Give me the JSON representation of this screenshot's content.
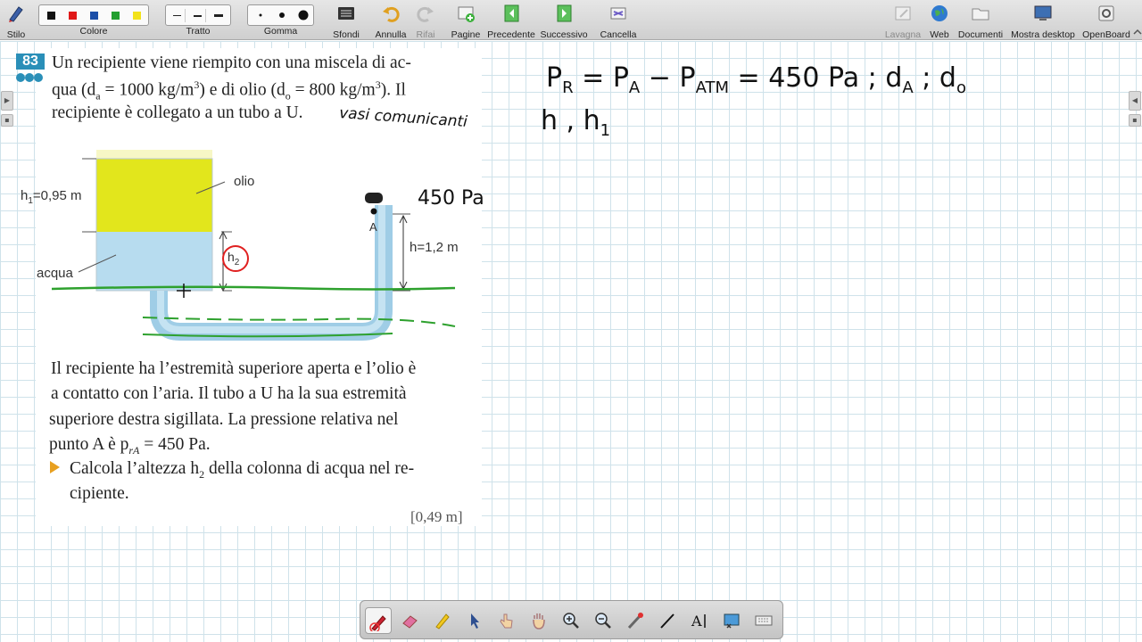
{
  "toolbar": {
    "stylus_label": "Stilo",
    "color_label": "Colore",
    "stroke_label": "Tratto",
    "eraser_label": "Gomma",
    "backgrounds_label": "Sfondi",
    "undo_label": "Annulla",
    "redo_label": "Rifai",
    "pages_label": "Pagine",
    "previous_label": "Precedente",
    "next_label": "Successivo",
    "clear_label": "Cancella",
    "board_label": "Lavagna",
    "web_label": "Web",
    "documents_label": "Documenti",
    "show_desktop_label": "Mostra desktop",
    "app_label": "OpenBoard",
    "colors": [
      "#111111",
      "#e01818",
      "#1c4fa8",
      "#22a030",
      "#f2e21a"
    ]
  },
  "exercise": {
    "number": "83",
    "intro_lines": [
      "Un recipiente viene riempito con una miscela di ac-",
      "qua (d",
      "a",
      " = 1000 kg/m",
      "3",
      ") e di olio (d",
      "o",
      " = 800 kg/m",
      "3",
      "). Il",
      "recipiente è collegato a un tubo a U."
    ],
    "body_lines": [
      "Il recipiente ha l’estremità superiore aperta e l’olio è",
      "a contatto con l’aria. Il tubo a U ha la sua estremità",
      "superiore destra sigillata. La pressione relativa nel",
      "punto A è p",
      "rA",
      " = 450 Pa."
    ],
    "task_line1": "Calcola l’altezza h",
    "task_sub": "2",
    "task_line1_end": " della colonna di acqua nel re-",
    "task_line2": "cipiente.",
    "answer": "[0,49 m]"
  },
  "diagram": {
    "h1_label": "h",
    "h1_sub": "1",
    "h1_value": "=0,95 m",
    "oil_label": "olio",
    "water_label": "acqua",
    "h2_label": "h",
    "h2_sub": "2",
    "point_label": "A",
    "h_label": "h=1,2 m",
    "oil_color": "#e2e61c",
    "water_color": "#b7dcef"
  },
  "annotations": {
    "vasi_note": "vasi comunicanti",
    "pressure_note": "450 Pa",
    "formula_line1": "P",
    "formula_R": "R",
    "formula_eq": " = P",
    "formula_A": "A",
    "formula_minus": " − P",
    "formula_ATM": "ATM",
    "formula_value": " = 450 Pa    ;  d",
    "formula_dA": "A",
    "formula_semicolon": "  ;  d",
    "formula_d0": "o",
    "line2_h": "h  ,  h",
    "line2_sub": "1"
  }
}
